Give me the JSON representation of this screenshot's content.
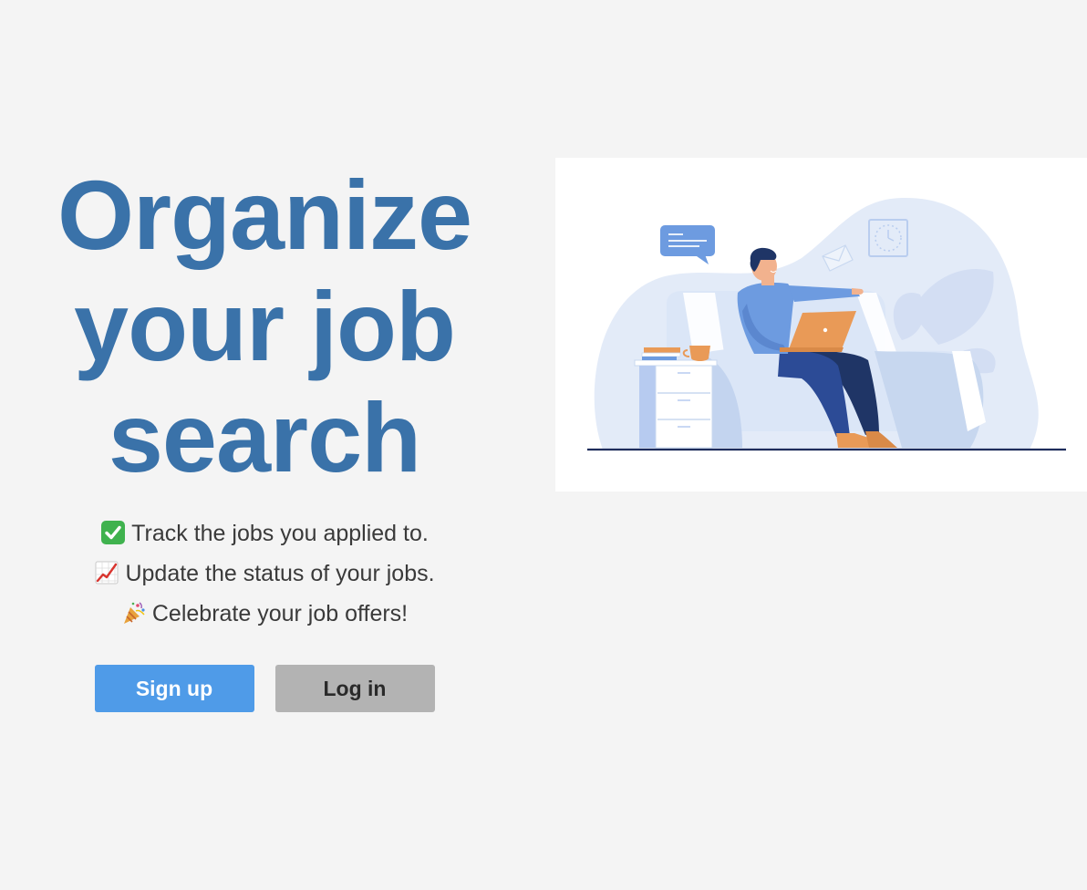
{
  "hero": {
    "headline_line1": "Organize",
    "headline_line2": "your job",
    "headline_line3": "search"
  },
  "features": [
    {
      "icon": "check-mark-icon",
      "text": "Track the jobs you applied to."
    },
    {
      "icon": "chart-increasing-icon",
      "text": "Update the status of your jobs."
    },
    {
      "icon": "party-popper-icon",
      "text": "Celebrate your job offers!"
    }
  ],
  "actions": {
    "signup_label": "Sign up",
    "login_label": "Log in"
  },
  "colors": {
    "background": "#f4f4f4",
    "headline": "#3a72a9",
    "signup_button": "#4f9be8",
    "login_button": "#b3b3b3"
  }
}
